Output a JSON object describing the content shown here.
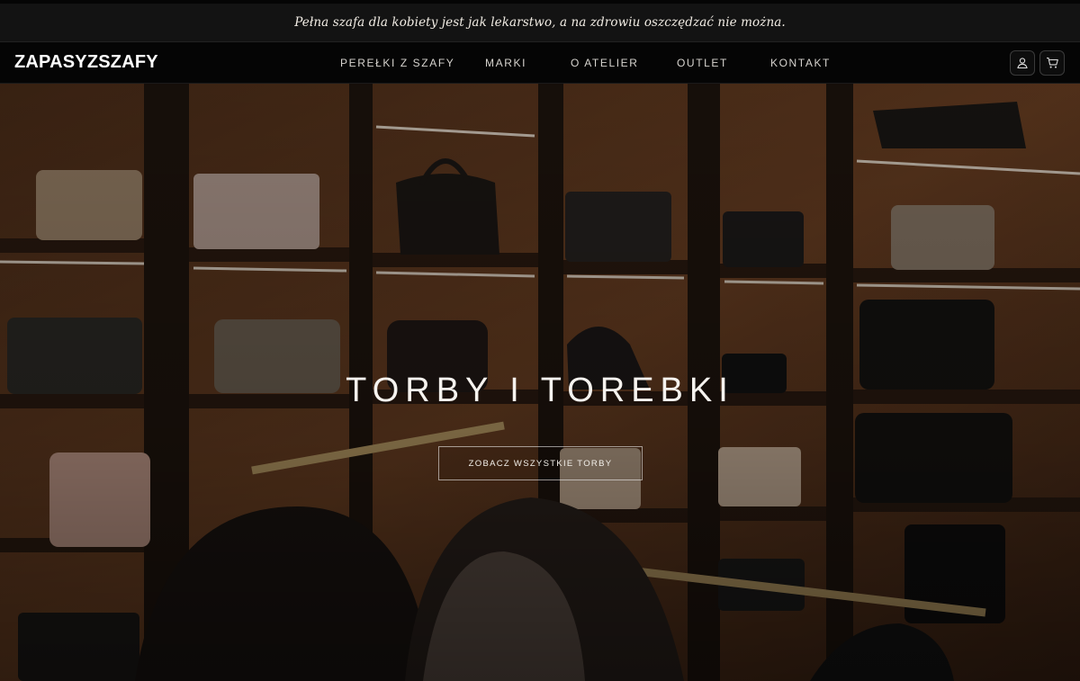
{
  "promo": {
    "text": "Pełna szafa dla kobiety jest jak lekarstwo, a na zdrowiu oszczędzać nie można."
  },
  "header": {
    "logo": "ZAPASYZSZAFY",
    "nav": [
      {
        "label": "PEREŁKI Z SZAFY"
      },
      {
        "label": "MARKI"
      },
      {
        "label": "O ATELIER"
      },
      {
        "label": "OUTLET"
      },
      {
        "label": "KONTAKT"
      }
    ],
    "icons": {
      "account": "user-icon",
      "cart": "cart-icon"
    }
  },
  "hero": {
    "title": "TORBY I TOREBKI",
    "cta": "ZOBACZ WSZYSTKIE TORBY"
  },
  "colors": {
    "promo_bg": "#131313",
    "header_bg": "#050505",
    "wood": "#5a3620",
    "shelf_light": "#f4ede0"
  }
}
